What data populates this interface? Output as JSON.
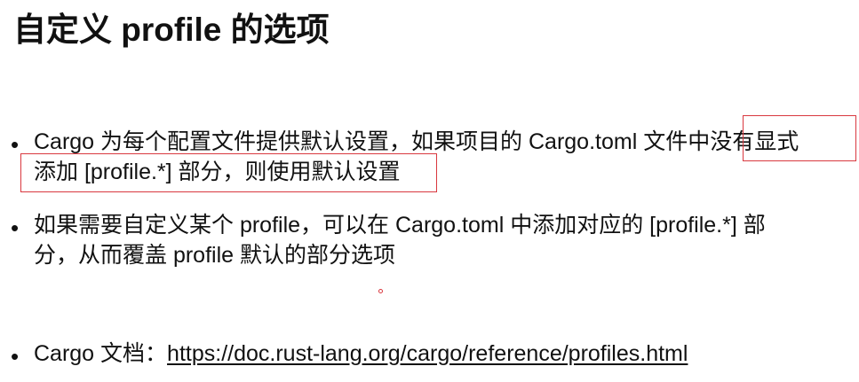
{
  "slide": {
    "title": "自定义 profile 的选项"
  },
  "bullets": [
    {
      "line1": "Cargo 为每个配置文件提供默认设置，如果项目的 Cargo.toml 文件中没有显式",
      "line2": "添加 [profile.*] 部分，则使用默认设置"
    },
    {
      "line1": "如果需要自定义某个 profile，可以在 Cargo.toml 中添加对应的 [profile.*] 部",
      "line2": "分，从而覆盖 profile 默认的部分选项"
    },
    {
      "prefix": "Cargo 文档：",
      "link": "https://doc.rust-lang.org/cargo/reference/profiles.html"
    }
  ],
  "bullet_glyph": "•",
  "annotation_color": "#d9383f"
}
